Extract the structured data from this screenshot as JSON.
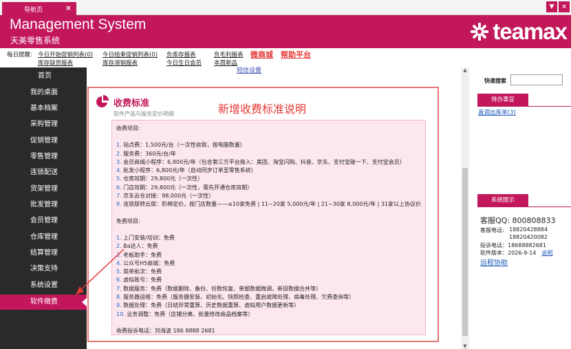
{
  "tabs": [
    {
      "label": "导航页",
      "close": "×"
    }
  ],
  "window": {
    "menu_glyph": "▼",
    "close_glyph": "×"
  },
  "header": {
    "title": "Management System",
    "subtitle": "天美零售系统",
    "brand_text": "teamax",
    "bg_color": "#c2185b"
  },
  "reminder": {
    "label": "每日提醒:",
    "links": [
      "今日开始促销列表(0)",
      "今日结束促销列表(0)",
      "负库存报表",
      "负毛利报表",
      "库存缺货报表",
      "库存滞销报表",
      "今日生日会员",
      "本周新品"
    ],
    "highlight1": "微商城",
    "highlight2": "帮助平台"
  },
  "sidebar": {
    "items": [
      "首页",
      "我的桌面",
      "基本档案",
      "采购管理",
      "促销管理",
      "零售管理",
      "连锁配送",
      "货架管理",
      "批发管理",
      "会员管理",
      "仓库管理",
      "结算管理",
      "决策支持",
      "系统设置",
      "软件缴费"
    ],
    "active_index": 14
  },
  "main": {
    "sms_link": "短信设置",
    "fee": {
      "icon": "pie-chart-icon",
      "title": "收费标准",
      "subtitle": "软件产品与服务定价明细",
      "note": "新增收费标准说明",
      "paid_header": "收费项目:",
      "paid_items": [
        {
          "num": "1.",
          "text": " 站点费：1,500元/台（一次性收取，按电脑数量）"
        },
        {
          "num": "2.",
          "text": " 服务费：360元/台/年"
        },
        {
          "num": "3.",
          "text": " 会员商城小程序：6,800元/年（包含第三方平台接入：美团、淘宝闪购、抖音、京东、支付宝碰一下、支付宝会员）"
        },
        {
          "num": "4.",
          "text": " 批发小程序：6,800元/年（自动同步订单至零售系统）"
        },
        {
          "num": "5.",
          "text": " 仓库效期：29,800元（一次性）"
        },
        {
          "num": "6.",
          "text": " 门店效期：29,800元（一次性，需先开通仓库效期）"
        },
        {
          "num": "7.",
          "text": " 京东云仓对接：98,000元（一次性）"
        },
        {
          "num": "8.",
          "text": " 连锁版转云版：阶梯定价，按门店数量——≤10家免费 | 11~20家 5,000元/年 | 21~30家 8,000元/年 | 31家以上协议价"
        }
      ],
      "free_header": "免费项目:",
      "free_items": [
        {
          "num": "1.",
          "text": " 上门安装/培训：免费"
        },
        {
          "num": "2.",
          "text": " Ba达人：免费"
        },
        {
          "num": "3.",
          "text": " 老板助手：免费"
        },
        {
          "num": "4.",
          "text": " 公众号H5商城：免费"
        },
        {
          "num": "5.",
          "text": " 简单批次：免费"
        },
        {
          "num": "6.",
          "text": " 虚拟账号：免费"
        },
        {
          "num": "7.",
          "text": " 数据服务：免费（数据删除、备份、份数恢复、单据数据微调、新旧数据合并等）"
        },
        {
          "num": "8.",
          "text": " 服务器运维：免费（服务器安装、初始化、快照检查、重启故障处理、病毒处理、欠费查询等）"
        },
        {
          "num": "9.",
          "text": " 数据处理：免费（日结异常重算、历史数据重算、虚拟用户数据更新等）"
        },
        {
          "num": "10.",
          "text": " 业务调整：免费（店铺分离、批量修改商品档案等）"
        }
      ],
      "complaint": "收费投诉电话：刘海波 186 8888 2681"
    }
  },
  "right_panel": {
    "search_label": "快速搜索",
    "search_value": "",
    "pending_title": "待办事宜",
    "pending_link": "直调出库单(3)",
    "system_title": "系统提示",
    "qq": "客服QQ:  800808833",
    "phone_label": "客服电话:",
    "phone1": "18820428884",
    "phone2": "18820420082",
    "complaint_phone": "投诉电话：18688882681",
    "version": "软件版本：2026-9-14",
    "manual": "说明",
    "remote": "远程协助"
  }
}
